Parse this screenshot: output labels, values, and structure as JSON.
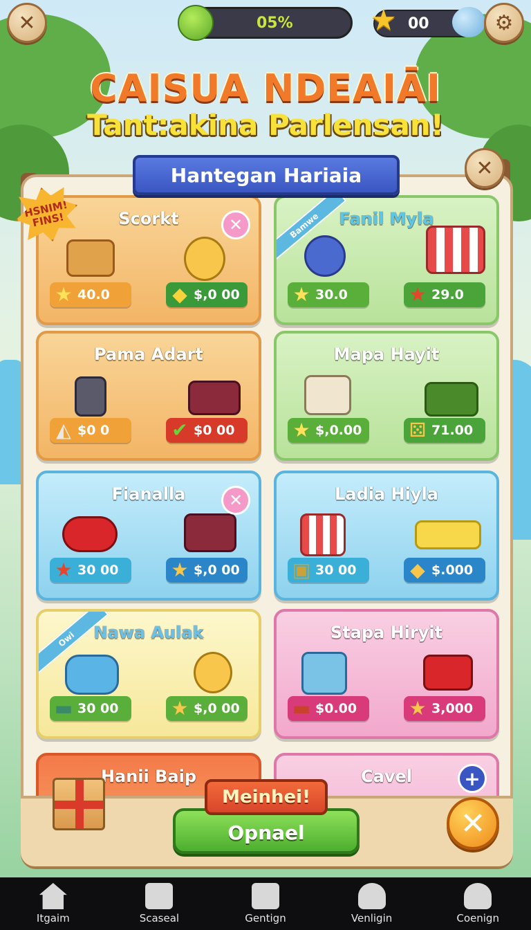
{
  "hud": {
    "energy_value": "05%",
    "star_count": "00"
  },
  "title": {
    "line1": "CAISUA NDEAIĀI",
    "line2": "Tant:akina Parlensan!"
  },
  "panel": {
    "banner": "Hantegan Hariaia",
    "badge": "HSNIM! FINS!"
  },
  "cards": [
    {
      "name": "Scorkt",
      "left_price": "40.0",
      "right_price": "$,0 00",
      "left_icon": "star",
      "right_icon": "diamond"
    },
    {
      "name": "Fanil Myla",
      "left_price": "30.0",
      "right_price": "29.0",
      "left_icon": "star",
      "right_icon": "star",
      "ribbon": "Bamwe"
    },
    {
      "name": "Pama Adart",
      "left_price": "$0 0",
      "right_price": "$0 00",
      "left_icon": "fan",
      "right_icon": "check"
    },
    {
      "name": "Mapa Hayit",
      "left_price": "$,0.00",
      "right_price": "71.00",
      "left_icon": "star",
      "right_icon": "die"
    },
    {
      "name": "Fianalla",
      "left_price": "30 00",
      "right_price": "$,0 00",
      "left_icon": "star",
      "right_icon": "star"
    },
    {
      "name": "Ladia Hiyla",
      "left_price": "30 00",
      "right_price": "$.000",
      "left_icon": "gift",
      "right_icon": "diamond"
    },
    {
      "name": "Nawa Aulak",
      "left_price": "30 00",
      "right_price": "$,0 00",
      "left_icon": "cash",
      "right_icon": "star",
      "ribbon": "Owi"
    },
    {
      "name": "Stapa Hiryit",
      "left_price": "$0.00",
      "right_price": "3,000",
      "left_icon": "cash",
      "right_icon": "star"
    },
    {
      "name": "Hanii Baip"
    },
    {
      "name": "Cavel"
    }
  ],
  "actions": {
    "tag": "Meinhei!",
    "open": "Opnael"
  },
  "nav": [
    {
      "label": "Itgaim",
      "icon": "home-icon"
    },
    {
      "label": "Scaseal",
      "icon": "tool-icon"
    },
    {
      "label": "Gentign",
      "icon": "edit-icon"
    },
    {
      "label": "Venligin",
      "icon": "user-icon"
    },
    {
      "label": "Coenign",
      "icon": "profile-icon"
    }
  ],
  "colors": {
    "card_orange": "#f6c27a",
    "card_green": "#c8e8a4",
    "card_blue": "#a8dcf2",
    "card_yellow": "#fbf2b4",
    "card_pink": "#f5b6d6"
  }
}
